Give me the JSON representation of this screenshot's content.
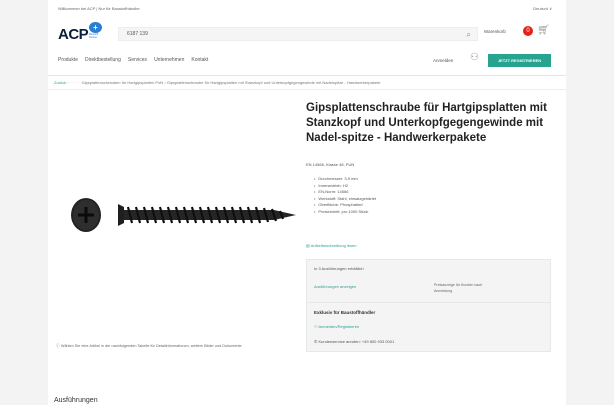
{
  "topbar": {
    "left": "Willkommen bei ACP | Nur für Baustoffhändler",
    "right": "Deutsch ∨"
  },
  "logo": {
    "text": "ACP",
    "badge": "+",
    "sub": "Baustoff Partner"
  },
  "search": {
    "value": "6187 139"
  },
  "cart": {
    "label": "Warenkorb",
    "count": "0"
  },
  "nav": {
    "items": [
      "Produkte",
      "Direktbestellung",
      "Services",
      "Unternehmen",
      "Kontakt"
    ]
  },
  "account": {
    "login_label": "Anmelden",
    "register_button": "JETZT REGISTRIEREN"
  },
  "breadcrumb": {
    "first": "Zurück",
    "second": "Gipsplattenschrauben für Hartgipsplatten PoN",
    "current": "Gipsplattenschraube für Hartgipsplatten mit Stanzkopf und Unterkopfgegengewinde mit Nadelspitze - Handwerkerpakete"
  },
  "product": {
    "title": "Gipsplattenschraube für Hartgipsplatten mit Stanzkopf und Unterkopfgegengewinde mit Nadel-spitze - Handwerkerpakete",
    "spec_head": "EN 14566, Klasse 48, PUN",
    "specs": [
      "Durchmesser: 3,9 mm",
      "Innenantrieb: H2",
      "EN-Norm: 14566",
      "Werkstoff: Stahl, einsatzgehärtet",
      "Oberfläche: Phosphatiert",
      "Preiseinheit: pro 1000 Stück"
    ],
    "desc_link": "Artikelbeschreibung lesen"
  },
  "variants": {
    "available": "In 3 Ausführungen erhältlich",
    "show": "Ausführungen anzeigen",
    "price_note": "Preisanzeige für Kunden nach Anmeldung"
  },
  "dealer": {
    "heading": "Exklusiv für Baustoffhändler",
    "login_link": "Anmelden/Registrieren",
    "service": "Kundenservice anrufen: +49 800 933 0001"
  },
  "image_note": "Wählen Sie eine Artikel in der nachfolgenden Tabelle für Detailinformationen, weitere Bilder und Dokumente",
  "section_heading": "Ausführungen",
  "colors": {
    "accent": "#27a38f",
    "badge": "#e2231a",
    "brand": "#0b1f3a"
  }
}
